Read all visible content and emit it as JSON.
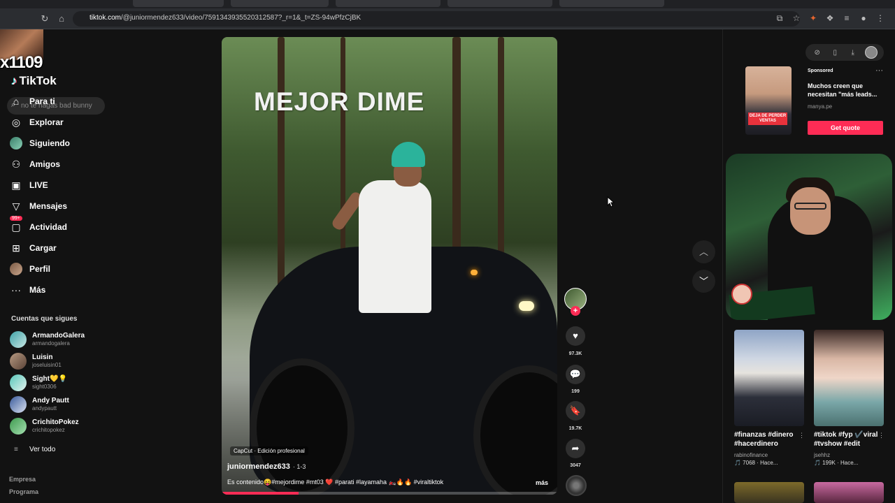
{
  "browser": {
    "url_host": "tiktok.com",
    "url_path": "/@juniormendez633/video/7591343935520312587?_r=1&_t=ZS-94wPfzCjBK"
  },
  "overlay_tag": "x1109",
  "sidebar": {
    "logo": "TikTok",
    "search_placeholder": "no te hagas bad bunny",
    "nav": [
      {
        "label": "Para ti",
        "icon": "home-icon"
      },
      {
        "label": "Explorar",
        "icon": "compass-icon"
      },
      {
        "label": "Siguiendo",
        "icon": "following-avatar-icon"
      },
      {
        "label": "Amigos",
        "icon": "friends-icon"
      },
      {
        "label": "LIVE",
        "icon": "live-icon"
      },
      {
        "label": "Mensajes",
        "icon": "messages-icon"
      },
      {
        "label": "Actividad",
        "icon": "activity-icon",
        "badge": "99+"
      },
      {
        "label": "Cargar",
        "icon": "upload-icon"
      },
      {
        "label": "Perfil",
        "icon": "profile-icon"
      },
      {
        "label": "Más",
        "icon": "more-dots-icon"
      }
    ],
    "following_title": "Cuentas que sigues",
    "following": [
      {
        "name": "ArmandoGalera",
        "handle": "armandogalera"
      },
      {
        "name": "Luisin",
        "handle": "joseluisin01"
      },
      {
        "name": "Sight💛💡",
        "handle": "sight0306"
      },
      {
        "name": "Andy Pautt",
        "handle": "andypautt"
      },
      {
        "name": "CrichitoPokez",
        "handle": "crichitopokez"
      }
    ],
    "see_all": "Ver todo",
    "footer": [
      "Empresa",
      "Programa"
    ]
  },
  "video": {
    "title": "MEJOR DIME",
    "capcut": "CapCut · Edición profesional",
    "author": "juniormendez633",
    "date": "· 1-3",
    "caption": "Es contenido😝#mejordime #mt03 ❤️ #parati #layamaha 🏍️🔥🔥 #viraltiktok",
    "more": "más",
    "progress": 0.23
  },
  "actions": {
    "likes": "97.3K",
    "comments": "199",
    "saves": "19.7K",
    "shares": "3047"
  },
  "right_panel": {
    "ad": {
      "sponsored": "Sponsored",
      "text": "Muchos creen que necesitan \"más leads...",
      "domain": "manya.pe",
      "cta": "Get quote",
      "image_badge": "DEJA DE PERDER VENTAS"
    },
    "thumbnails": [
      {
        "caption": "#finanzas #dinero #hacerdinero",
        "channel": "rabinofinance",
        "meta": "🎵 7068 · Hace..."
      },
      {
        "caption": "#tiktok #fyp ✔️viral #tvshow #edit",
        "channel": "jsehhz",
        "meta": "🎵 199K · Hace..."
      }
    ]
  },
  "colors": {
    "accent": "#fe2c55",
    "background": "#121212"
  }
}
